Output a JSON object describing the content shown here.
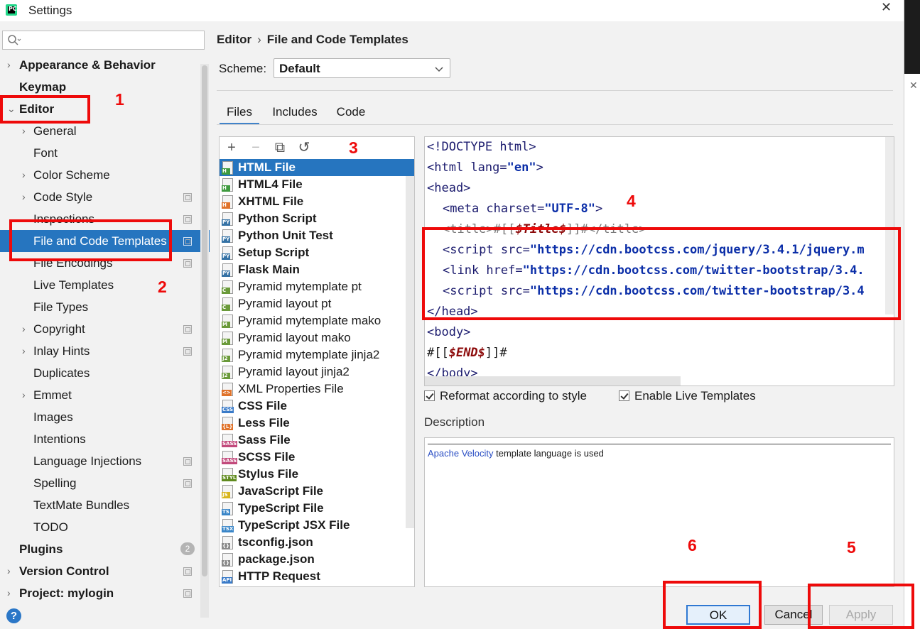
{
  "window": {
    "title": "Settings",
    "close_symbol": "✕"
  },
  "search": {
    "placeholder": "",
    "value": ""
  },
  "sidebar": {
    "items": [
      {
        "label": "Appearance & Behavior",
        "level": 0,
        "bold": true,
        "arrow": "›"
      },
      {
        "label": "Keymap",
        "level": 0,
        "bold": true,
        "arrow": ""
      },
      {
        "label": "Editor",
        "level": 0,
        "bold": true,
        "arrow": "⌄"
      },
      {
        "label": "General",
        "level": 1,
        "arrow": "›"
      },
      {
        "label": "Font",
        "level": 1,
        "arrow": ""
      },
      {
        "label": "Color Scheme",
        "level": 1,
        "arrow": "›"
      },
      {
        "label": "Code Style",
        "level": 1,
        "arrow": "›",
        "project_icon": true
      },
      {
        "label": "Inspections",
        "level": 1,
        "arrow": "",
        "project_icon": true
      },
      {
        "label": "File and Code Templates",
        "level": 1,
        "arrow": "",
        "project_icon": true,
        "selected": true
      },
      {
        "label": "File Encodings",
        "level": 1,
        "arrow": "",
        "project_icon": true
      },
      {
        "label": "Live Templates",
        "level": 1,
        "arrow": ""
      },
      {
        "label": "File Types",
        "level": 1,
        "arrow": ""
      },
      {
        "label": "Copyright",
        "level": 1,
        "arrow": "›",
        "project_icon": true
      },
      {
        "label": "Inlay Hints",
        "level": 1,
        "arrow": "›",
        "project_icon": true
      },
      {
        "label": "Duplicates",
        "level": 1,
        "arrow": ""
      },
      {
        "label": "Emmet",
        "level": 1,
        "arrow": "›"
      },
      {
        "label": "Images",
        "level": 1,
        "arrow": ""
      },
      {
        "label": "Intentions",
        "level": 1,
        "arrow": ""
      },
      {
        "label": "Language Injections",
        "level": 1,
        "arrow": "",
        "project_icon": true
      },
      {
        "label": "Spelling",
        "level": 1,
        "arrow": "",
        "project_icon": true
      },
      {
        "label": "TextMate Bundles",
        "level": 1,
        "arrow": ""
      },
      {
        "label": "TODO",
        "level": 1,
        "arrow": ""
      },
      {
        "label": "Plugins",
        "level": 0,
        "bold": true,
        "arrow": "",
        "badge": "2"
      },
      {
        "label": "Version Control",
        "level": 0,
        "bold": true,
        "arrow": "›",
        "project_icon": true
      },
      {
        "label": "Project: mylogin",
        "level": 0,
        "bold": true,
        "arrow": "›",
        "project_icon": true
      }
    ],
    "help_symbol": "?"
  },
  "breadcrumb": {
    "parent": "Editor",
    "separator": "›",
    "current": "File and Code Templates"
  },
  "scheme": {
    "label": "Scheme:",
    "value": "Default"
  },
  "tabs": [
    "Files",
    "Includes",
    "Code"
  ],
  "toolbar": {
    "add": "+",
    "remove": "−",
    "copy": "⧉",
    "reset": "↺"
  },
  "templates": [
    {
      "name": "HTML File",
      "bold": true,
      "tag": "H",
      "tag_color": "#3f9b3f",
      "selected": true
    },
    {
      "name": "HTML4 File",
      "bold": true,
      "tag": "H",
      "tag_color": "#3f9b3f"
    },
    {
      "name": "XHTML File",
      "bold": true,
      "tag": "H",
      "tag_color": "#e0732b"
    },
    {
      "name": "Python Script",
      "bold": true,
      "tag": "PY",
      "tag_color": "#3572a5"
    },
    {
      "name": "Python Unit Test",
      "bold": true,
      "tag": "PY",
      "tag_color": "#3572a5"
    },
    {
      "name": "Setup Script",
      "bold": true,
      "tag": "PY",
      "tag_color": "#3572a5"
    },
    {
      "name": "Flask Main",
      "bold": true,
      "tag": "PY",
      "tag_color": "#3572a5"
    },
    {
      "name": "Pyramid mytemplate pt",
      "bold": false,
      "tag": "C",
      "tag_color": "#6a9a3a"
    },
    {
      "name": "Pyramid layout pt",
      "bold": false,
      "tag": "C",
      "tag_color": "#6a9a3a"
    },
    {
      "name": "Pyramid mytemplate mako",
      "bold": false,
      "tag": "M",
      "tag_color": "#6a9a3a"
    },
    {
      "name": "Pyramid layout mako",
      "bold": false,
      "tag": "M",
      "tag_color": "#6a9a3a"
    },
    {
      "name": "Pyramid mytemplate jinja2",
      "bold": false,
      "tag": "J2",
      "tag_color": "#6a9a3a"
    },
    {
      "name": "Pyramid layout jinja2",
      "bold": false,
      "tag": "J2",
      "tag_color": "#6a9a3a"
    },
    {
      "name": "XML Properties File",
      "bold": false,
      "tag": "<>",
      "tag_color": "#e0732b"
    },
    {
      "name": "CSS File",
      "bold": true,
      "tag": "CSS",
      "tag_color": "#3a7bc8"
    },
    {
      "name": "Less File",
      "bold": true,
      "tag": "{L}",
      "tag_color": "#e0732b"
    },
    {
      "name": "Sass File",
      "bold": true,
      "tag": "SASS",
      "tag_color": "#c24a7c"
    },
    {
      "name": "SCSS File",
      "bold": true,
      "tag": "SASS",
      "tag_color": "#c24a7c"
    },
    {
      "name": "Stylus File",
      "bold": true,
      "tag": "STYL",
      "tag_color": "#5f8a1e"
    },
    {
      "name": "JavaScript File",
      "bold": true,
      "tag": "JS",
      "tag_color": "#d8b51c"
    },
    {
      "name": "TypeScript File",
      "bold": true,
      "tag": "TS",
      "tag_color": "#3a86c8"
    },
    {
      "name": "TypeScript JSX File",
      "bold": true,
      "tag": "TSX",
      "tag_color": "#3a86c8"
    },
    {
      "name": "tsconfig.json",
      "bold": true,
      "tag": "{}",
      "tag_color": "#8a8a8a"
    },
    {
      "name": "package.json",
      "bold": true,
      "tag": "{}",
      "tag_color": "#8a8a8a"
    },
    {
      "name": "HTTP Request",
      "bold": true,
      "tag": "API",
      "tag_color": "#3a7bc8"
    }
  ],
  "editor": {
    "l1": {
      "a": "<!DOCTYPE ",
      "b": "html",
      "c": ">"
    },
    "l2": {
      "a": "<html ",
      "attr": "lang=",
      "val": "\"en\"",
      "c": ">"
    },
    "l3": "<head>",
    "l4": {
      "a": "<meta ",
      "attr": "charset=",
      "val": "\"UTF-8\"",
      "c": ">"
    },
    "l5": {
      "a": "<title>#[[",
      "kw": "$Title$",
      "c": "]]#</title>"
    },
    "l6": {
      "a": "<script ",
      "attr": "src=",
      "val": "\"https://cdn.bootcss.com/jquery/3.4.1/jquery.m"
    },
    "l7": {
      "a": "<link ",
      "attr": "href=",
      "val": "\"https://cdn.bootcss.com/twitter-bootstrap/3.4."
    },
    "l8": {
      "a": "<script ",
      "attr": "src=",
      "val": "\"https://cdn.bootcss.com/twitter-bootstrap/3.4"
    },
    "l9": "</head>",
    "l10": "<body>",
    "l11": {
      "a": "#[[",
      "kw": "$END$",
      "c": "]]#"
    },
    "l12": "</body>"
  },
  "options": {
    "reformat": "Reformat according to style",
    "live_templates": "Enable Live Templates"
  },
  "description": {
    "label": "Description",
    "link": "Apache Velocity",
    "text": " template language is used"
  },
  "buttons": {
    "ok": "OK",
    "cancel": "Cancel",
    "apply": "Apply"
  },
  "annotations": [
    "1",
    "2",
    "3",
    "4",
    "5",
    "6"
  ],
  "colors": {
    "accent": "#2675bf",
    "annotation": "#ee0a0a"
  }
}
